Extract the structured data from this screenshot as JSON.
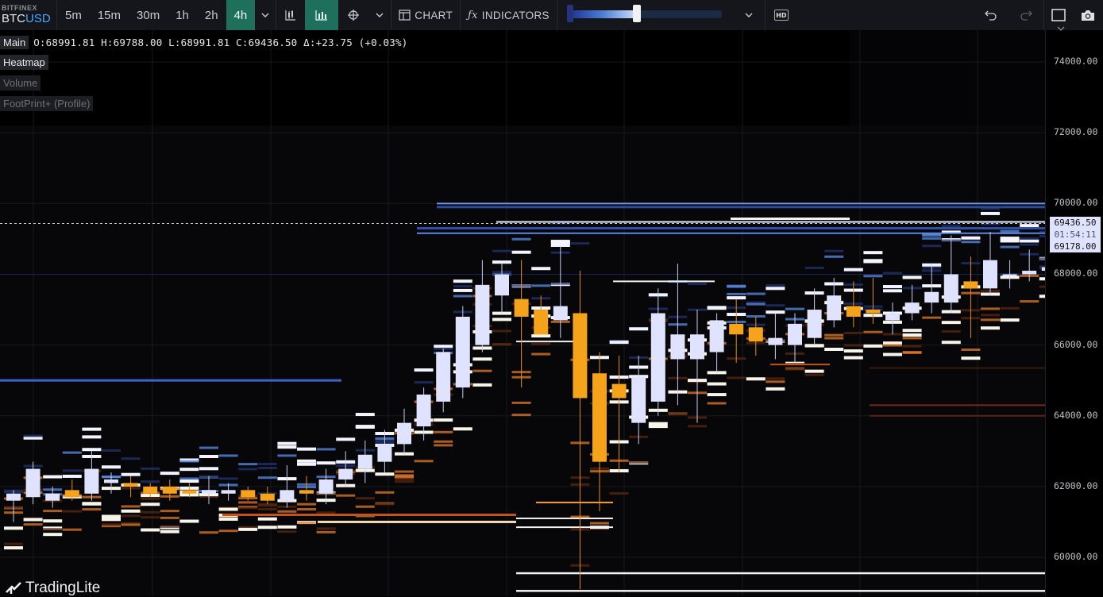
{
  "toolbar": {
    "exchange": "BITFINEX",
    "pair_base": "BTC",
    "pair_quote": "USD",
    "timeframes": [
      {
        "label": "5m",
        "active": false
      },
      {
        "label": "15m",
        "active": false
      },
      {
        "label": "30m",
        "active": false
      },
      {
        "label": "1h",
        "active": false
      },
      {
        "label": "2h",
        "active": false
      },
      {
        "label": "4h",
        "active": true
      }
    ],
    "chart_label": "CHART",
    "indicators_label": "INDICATORS",
    "hd_label": "HD",
    "heatmap_contrast_level": 0.45
  },
  "info": {
    "main_label": "Main",
    "ohlc": "O:68991.81 H:69788.00 L:68991.81 C:69436.50 Δ:+23.75 (+0.03%)"
  },
  "layers": [
    {
      "label": "Heatmap",
      "enabled": true
    },
    {
      "label": "Volume",
      "enabled": false
    },
    {
      "label": "FootPrint+ (Profile)",
      "enabled": false
    }
  ],
  "price_axis": {
    "ticks": [
      "74000.00",
      "72000.00",
      "70000.00",
      "68000.00",
      "66000.00",
      "64000.00",
      "62000.00",
      "60000.00"
    ],
    "last_price": "69436.50",
    "countdown": "01:54:11",
    "low_label": "69178.00"
  },
  "colors": {
    "up": "#dfe3ff",
    "down": "#f5a31a",
    "accent": "#1f6f5d",
    "line_blue": "#4a78d8"
  },
  "brand": "TradingLite",
  "chart_data": {
    "type": "candlestick",
    "ylim": [
      58900,
      74900
    ],
    "candles": [
      [
        61600,
        61900,
        61000,
        61800
      ],
      [
        61700,
        62700,
        61500,
        62500
      ],
      [
        61600,
        62000,
        61400,
        61800
      ],
      [
        61900,
        62200,
        61600,
        61700
      ],
      [
        61800,
        63000,
        61600,
        62500
      ],
      [
        62100,
        62400,
        61800,
        62200
      ],
      [
        62100,
        62300,
        61700,
        62000
      ],
      [
        62000,
        62100,
        61700,
        61800
      ],
      [
        62000,
        62200,
        61600,
        61800
      ],
      [
        61900,
        62100,
        61700,
        61800
      ],
      [
        61800,
        62300,
        61500,
        61900
      ],
      [
        61800,
        62100,
        61600,
        61900
      ],
      [
        61900,
        62000,
        61600,
        61700
      ],
      [
        61800,
        62000,
        61500,
        61600
      ],
      [
        61600,
        62600,
        61400,
        61900
      ],
      [
        61900,
        62300,
        61600,
        61800
      ],
      [
        61800,
        62500,
        61500,
        62200
      ],
      [
        62200,
        63000,
        62000,
        62500
      ],
      [
        62500,
        63300,
        62100,
        62900
      ],
      [
        62700,
        63600,
        62400,
        63200
      ],
      [
        63200,
        64200,
        62900,
        63800
      ],
      [
        63700,
        64800,
        63300,
        64600
      ],
      [
        64400,
        65900,
        64100,
        65800
      ],
      [
        64800,
        67100,
        64500,
        66800
      ],
      [
        66000,
        68400,
        65800,
        67700
      ],
      [
        67400,
        68300,
        66900,
        68000
      ],
      [
        67300,
        68400,
        64800,
        66800
      ],
      [
        67000,
        67400,
        66300,
        66300
      ],
      [
        66700,
        68800,
        66200,
        67100
      ],
      [
        66900,
        68100,
        59100,
        64500
      ],
      [
        65200,
        65800,
        61300,
        62700
      ],
      [
        64900,
        65700,
        62400,
        64500
      ],
      [
        63800,
        65700,
        63200,
        65100
      ],
      [
        64400,
        67600,
        64000,
        66900
      ],
      [
        65600,
        68300,
        64300,
        66300
      ],
      [
        65600,
        67000,
        63800,
        66300
      ],
      [
        65800,
        66900,
        65200,
        66700
      ],
      [
        66600,
        67300,
        65500,
        66300
      ],
      [
        66500,
        66800,
        65700,
        66100
      ],
      [
        66000,
        66900,
        65600,
        66200
      ],
      [
        66000,
        66900,
        65500,
        66600
      ],
      [
        66200,
        67600,
        66000,
        67000
      ],
      [
        66700,
        67900,
        66500,
        67400
      ],
      [
        67100,
        67800,
        66500,
        66800
      ],
      [
        67000,
        67900,
        66600,
        66900
      ],
      [
        66700,
        67200,
        66300,
        66900
      ],
      [
        66900,
        67700,
        66700,
        67200
      ],
      [
        67200,
        68300,
        66900,
        67500
      ],
      [
        67200,
        69100,
        66900,
        68000
      ],
      [
        67800,
        68500,
        66200,
        67600
      ],
      [
        67600,
        69200,
        67400,
        68400
      ],
      [
        68000,
        68400,
        67600,
        68000
      ],
      [
        68000,
        68700,
        67800,
        68100
      ],
      [
        68100,
        68600,
        67900,
        68200
      ],
      [
        68100,
        68700,
        67900,
        68200
      ],
      [
        68100,
        68400,
        67900,
        68000
      ],
      [
        68100,
        68500,
        67900,
        68100
      ],
      [
        68000,
        68500,
        67800,
        68200
      ],
      [
        68200,
        69100,
        68000,
        68600
      ],
      [
        68900,
        69500,
        68700,
        69400
      ]
    ]
  }
}
